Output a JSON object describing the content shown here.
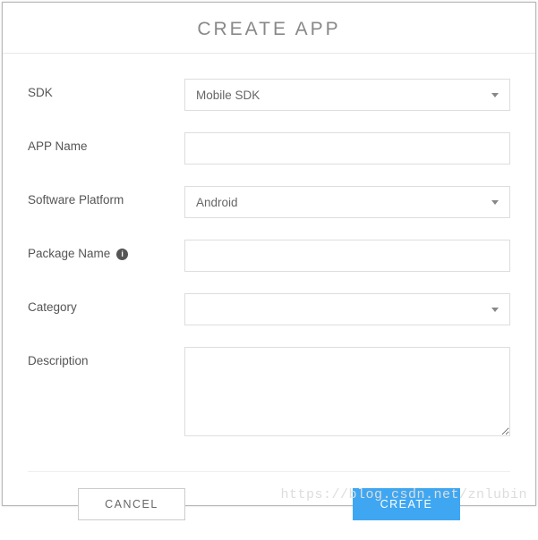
{
  "modal": {
    "title": "CREATE APP"
  },
  "form": {
    "sdk": {
      "label": "SDK",
      "value": "Mobile SDK"
    },
    "appName": {
      "label": "APP Name",
      "value": ""
    },
    "platform": {
      "label": "Software Platform",
      "value": "Android"
    },
    "packageName": {
      "label": "Package Name",
      "value": ""
    },
    "category": {
      "label": "Category",
      "value": ""
    },
    "description": {
      "label": "Description",
      "value": ""
    }
  },
  "actions": {
    "cancel": "CANCEL",
    "create": "CREATE"
  },
  "watermark": "https://blog.csdn.net/znlubin"
}
